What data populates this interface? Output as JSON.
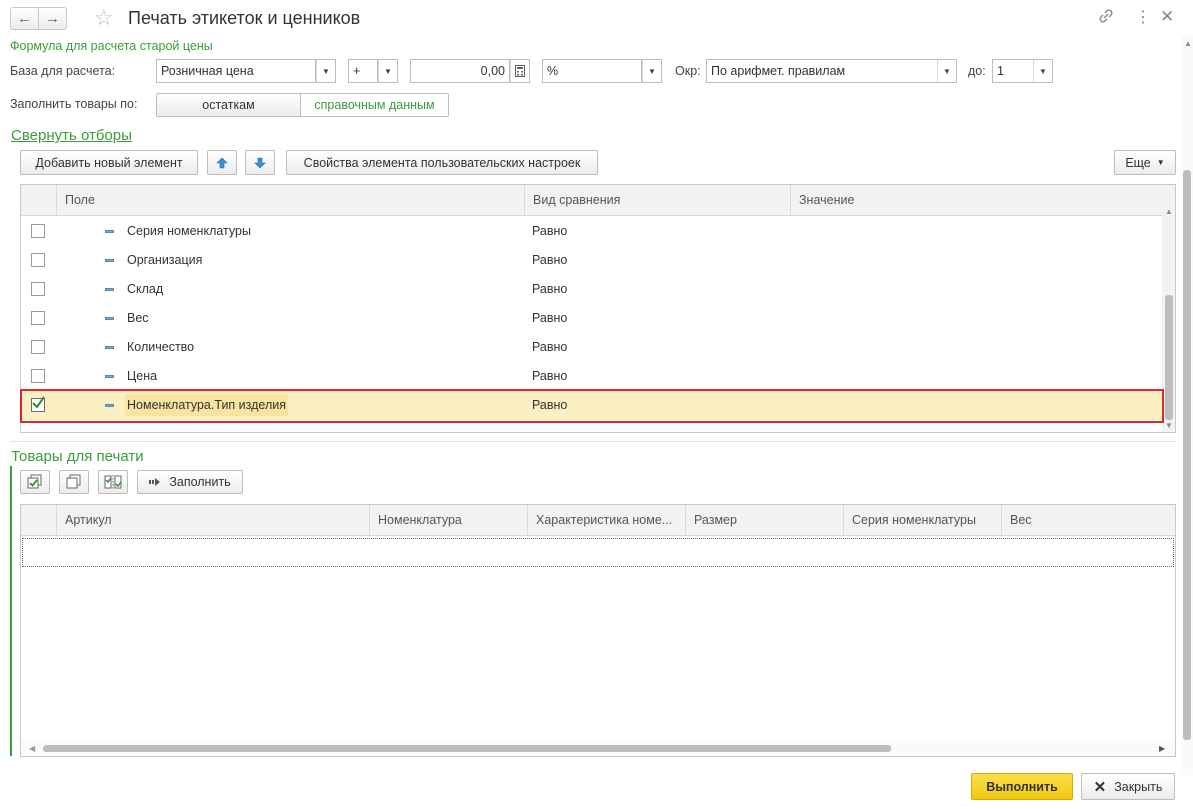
{
  "header": {
    "title": "Печать этикеток и ценников"
  },
  "pricing": {
    "formula_label": "Формула для расчета старой цены",
    "base_label": "База для расчета:",
    "base_value": "Розничная цена",
    "operator_value": "+",
    "amount_value": "0,00",
    "unit_value": "%",
    "round_label": "Окр:",
    "round_value": "По арифмет. правилам",
    "to_label": "до:",
    "to_value": "1"
  },
  "fill": {
    "label": "Заполнить товары по:",
    "option_stock": "остаткам",
    "option_reference": "справочным данным"
  },
  "filters": {
    "collapse_link": "Свернуть отборы",
    "add_button": "Добавить новый элемент",
    "properties_button": "Свойства элемента пользовательских настроек",
    "more_button": "Еще",
    "columns": {
      "field": "Поле",
      "comparison": "Вид сравнения",
      "value": "Значение"
    },
    "rows": [
      {
        "field": "Серия номенклатуры",
        "comparison": "Равно",
        "checked": false
      },
      {
        "field": "Организация",
        "comparison": "Равно",
        "checked": false
      },
      {
        "field": "Склад",
        "comparison": "Равно",
        "checked": false
      },
      {
        "field": "Вес",
        "comparison": "Равно",
        "checked": false
      },
      {
        "field": "Количество",
        "comparison": "Равно",
        "checked": false
      },
      {
        "field": "Цена",
        "comparison": "Равно",
        "checked": false
      },
      {
        "field": "Номенклатура.Тип изделия",
        "comparison": "Равно",
        "checked": true
      }
    ]
  },
  "goods": {
    "section_title": "Товары для печати",
    "fill_button": "Заполнить",
    "columns": [
      "Артикул",
      "Номенклатура",
      "Характеристика номе...",
      "Размер",
      "Серия номенклатуры",
      "Вес"
    ]
  },
  "footer": {
    "execute_button": "Выполнить",
    "close_button": "Закрыть"
  },
  "colors": {
    "accent_green": "#3a9c3a",
    "primary_button": "#f5d21f",
    "selection_row": "#fbefc4",
    "highlight_border": "#e0282a"
  }
}
